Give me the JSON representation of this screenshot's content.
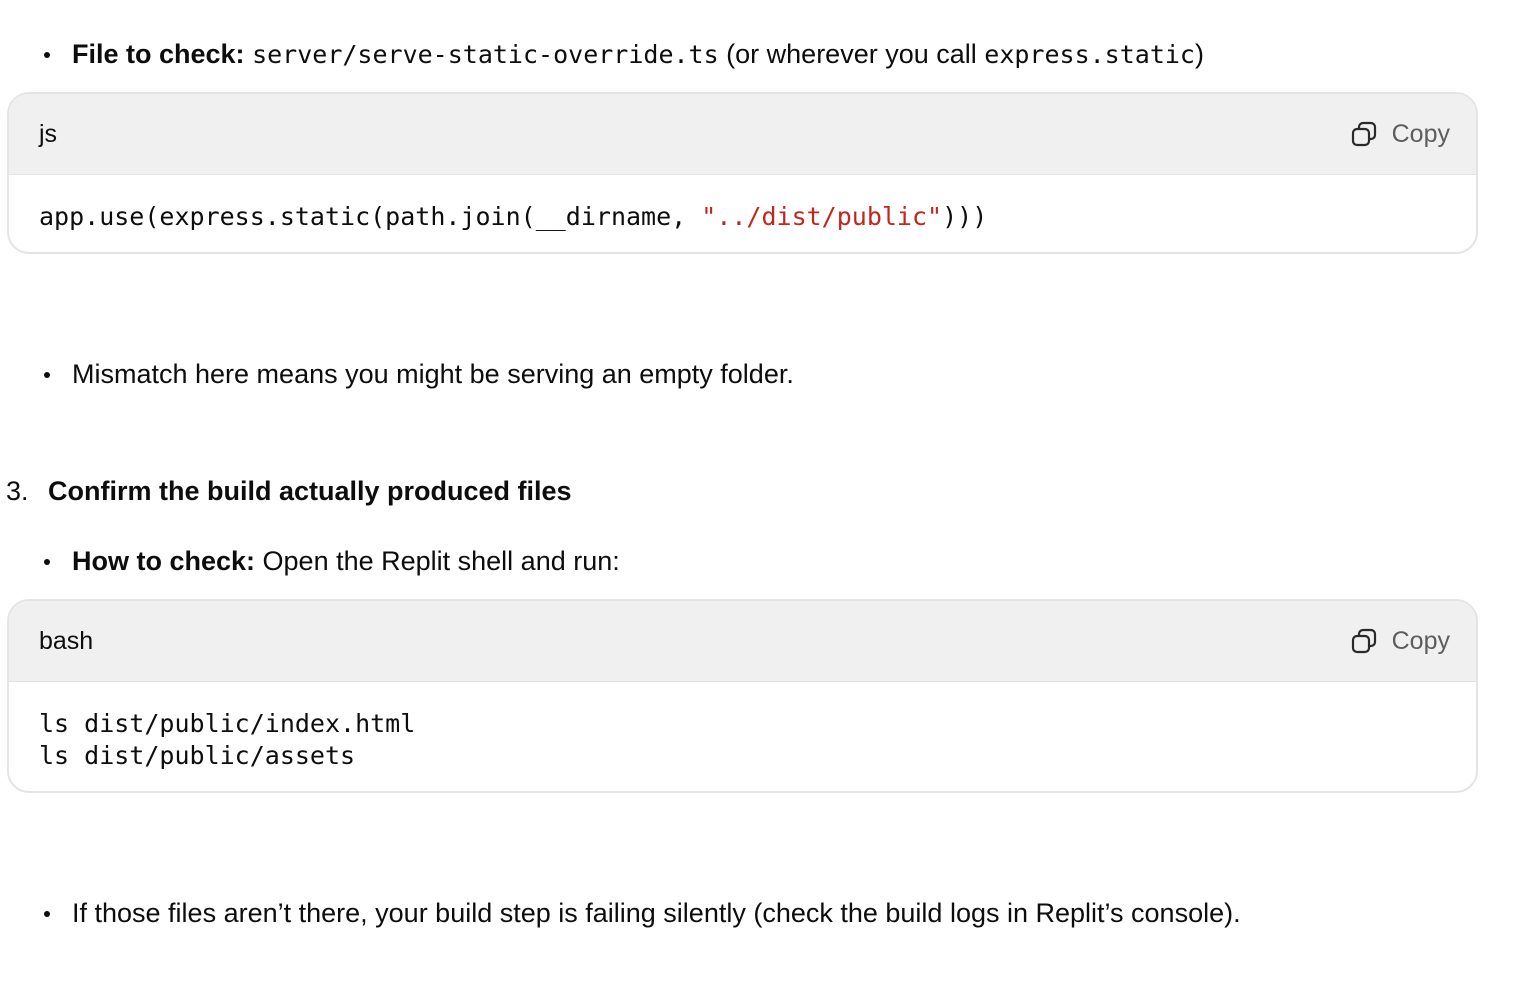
{
  "items": {
    "file_check": {
      "label": "File to check:",
      "path": "server/serve-static-override.ts",
      "middle_text": " (or wherever you call ",
      "code_ref": "express.static",
      "end_text": ")"
    },
    "mismatch": {
      "text": "Mismatch here means you might be serving an empty folder."
    },
    "step3": {
      "number": "3.",
      "title": "Confirm the build actually produced files"
    },
    "how_to_check": {
      "label": "How to check:",
      "text": " Open the Replit shell and run:"
    },
    "if_missing": {
      "text": "If those files aren’t there, your build step is failing silently (check the build logs in Replit’s console)."
    }
  },
  "code_blocks": {
    "js": {
      "language": "js",
      "copy_label": "Copy",
      "line1_pre": "app.use(express.static(path.join(__dirname, ",
      "line1_str": "\"../dist/public\"",
      "line1_post": ")))"
    },
    "bash": {
      "language": "bash",
      "copy_label": "Copy",
      "line1": "ls dist/public/index.html",
      "line2": "ls dist/public/assets"
    }
  },
  "icons": {
    "copy": "copy-icon"
  }
}
